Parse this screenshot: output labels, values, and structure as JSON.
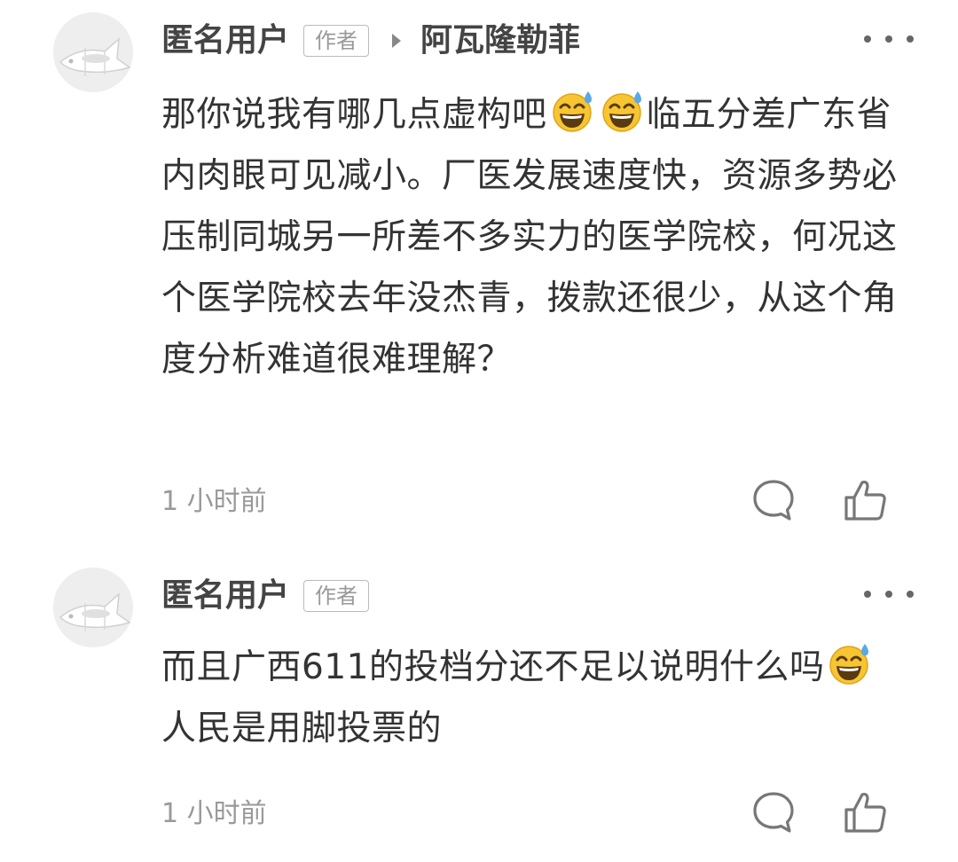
{
  "comments": [
    {
      "username": "匿名用户",
      "badge": "作者",
      "reply_to": "阿瓦隆勒菲",
      "avatar_icon": "fish-avatar-icon",
      "text_segments": [
        {
          "type": "text",
          "value": "那你说我有哪几点虚构吧"
        },
        {
          "type": "emoji",
          "value": "grinning-sweat-emoji"
        },
        {
          "type": "emoji",
          "value": "grinning-sweat-emoji"
        },
        {
          "type": "text",
          "value": "临五分差广东省内肉眼可见减小。厂医发展速度快，资源多势必压制同城另一所差不多实力的医学院校，何况这个医学院校去年没杰青，拨款还很少，从这个角度分析难道很难理解？"
        }
      ],
      "time": "1 小时前",
      "reply_icon": "comment-bubble-icon",
      "like_icon": "thumbs-up-icon",
      "more_icon": "more-dots-icon"
    },
    {
      "username": "匿名用户",
      "badge": "作者",
      "avatar_icon": "fish-avatar-icon",
      "text_segments": [
        {
          "type": "text",
          "value": "而且广西611的投档分还不足以说明什么吗"
        },
        {
          "type": "emoji",
          "value": "grinning-sweat-emoji"
        },
        {
          "type": "text",
          "value": "人民是用脚投票的"
        }
      ],
      "time": "1 小时前",
      "reply_icon": "comment-bubble-icon",
      "like_icon": "thumbs-up-icon",
      "more_icon": "more-dots-icon"
    }
  ],
  "colors": {
    "text_primary": "#333333",
    "username": "#444444",
    "meta_gray": "#999999",
    "icon_gray": "#666666",
    "emoji_yellow": "#f7c531",
    "emoji_sweat": "#5aa9e6"
  }
}
